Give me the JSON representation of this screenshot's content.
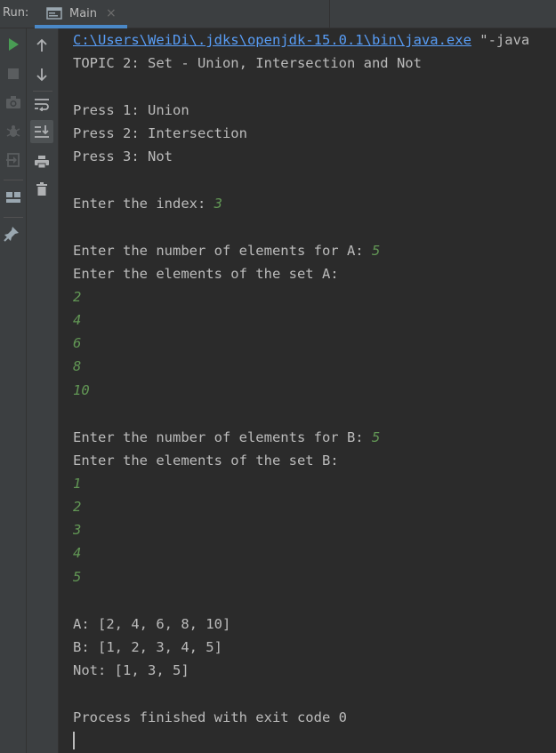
{
  "topbar": {
    "run_label": "Run:",
    "tab_title": "Main",
    "tab_close": "×"
  },
  "toolbar_left": {
    "items": [
      "run-icon",
      "stop-icon",
      "camera-icon",
      "debug-icon",
      "exit-icon",
      "layout-icon",
      "pin-icon"
    ]
  },
  "toolbar_right": {
    "items": [
      "arrow-up-icon",
      "arrow-down-icon",
      "soft-wrap-icon",
      "scroll-to-end-icon",
      "print-icon",
      "trash-icon"
    ]
  },
  "console": {
    "command_path": "C:\\Users\\WeiDi\\.jdks\\openjdk-15.0.1\\bin\\java.exe",
    "command_rest": " \"-java",
    "topic": "TOPIC 2: Set - Union, Intersection and Not",
    "press1": "Press 1: Union",
    "press2": "Press 2: Intersection",
    "press3": "Press 3: Not",
    "enter_index": "Enter the index: ",
    "index_value": "3",
    "count_a_prompt": "Enter the number of elements for A: ",
    "count_a": "5",
    "elements_a_prompt": "Enter the elements of the set A:",
    "a_inputs": [
      "2",
      "4",
      "6",
      "8",
      "10"
    ],
    "count_b_prompt": "Enter the number of elements for B: ",
    "count_b": "5",
    "elements_b_prompt": "Enter the elements of the set B:",
    "b_inputs": [
      "1",
      "2",
      "3",
      "4",
      "5"
    ],
    "result_a": "A: [2, 4, 6, 8, 10]",
    "result_b": "B: [1, 2, 3, 4, 5]",
    "result_not": "Not: [1, 3, 5]",
    "exit_line": "Process finished with exit code 0"
  },
  "colors": {
    "background": "#2b2b2b",
    "toolbar": "#3c3f41",
    "text": "#bbbbbb",
    "link": "#589df6",
    "user_input": "#629755",
    "run_green": "#499c54",
    "tab_accent": "#4a88c7"
  }
}
